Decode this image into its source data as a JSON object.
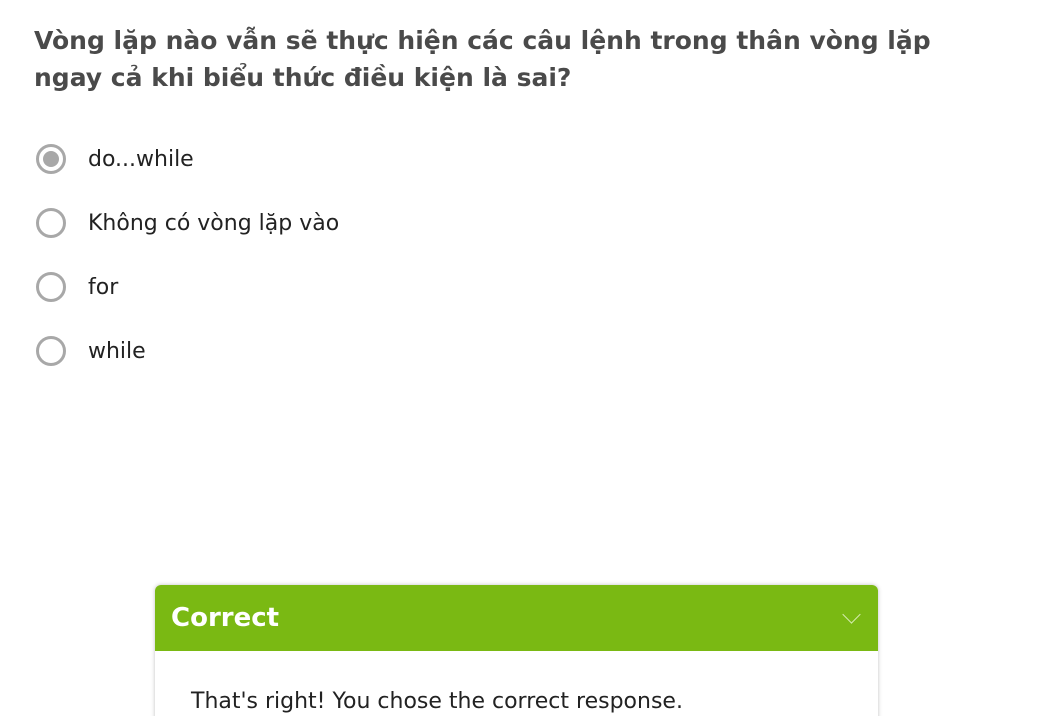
{
  "question": {
    "text": "Vòng lặp nào vẫn sẽ thực hiện các câu lệnh trong thân vòng lặp ngay cả khi biểu thức điều kiện là sai?"
  },
  "options": [
    {
      "label": "do...while",
      "selected": true
    },
    {
      "label": "Không có vòng lặp vào",
      "selected": false
    },
    {
      "label": "for",
      "selected": false
    },
    {
      "label": "while",
      "selected": false
    }
  ],
  "feedback": {
    "title": "Correct",
    "message": "That's right! You chose the correct response.",
    "header_color": "#7ab913",
    "expand_icon": "chevron-down-icon"
  },
  "colors": {
    "question_text": "#4a4a4a",
    "radio": "#a8a8a8"
  }
}
